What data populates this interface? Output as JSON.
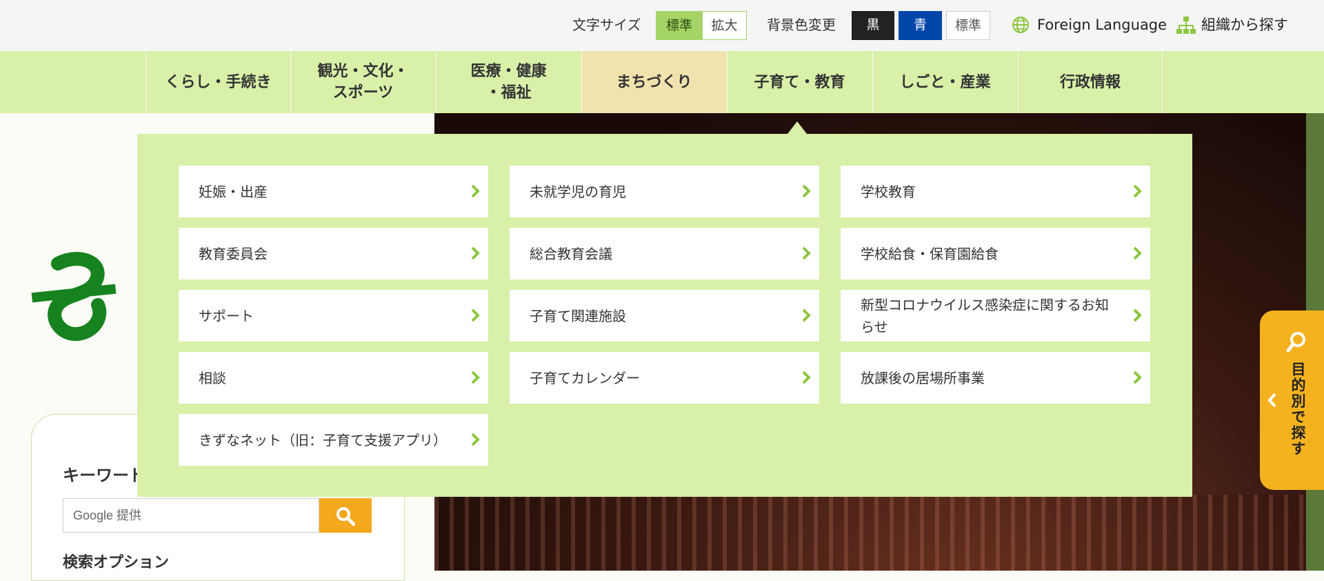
{
  "utility": {
    "font_size_label": "文字サイズ",
    "font_size_standard": "標準",
    "font_size_large": "拡大",
    "bg_color_label": "背景色変更",
    "bg_black": "黒",
    "bg_blue": "青",
    "bg_standard": "標準",
    "foreign_language": "Foreign Language",
    "org_search": "組織から探す"
  },
  "nav": {
    "items": [
      {
        "label": "くらし・手続き"
      },
      {
        "label": "観光・文化・\nスポーツ"
      },
      {
        "label": "医療・健康\n・福祉"
      },
      {
        "label": "まちづくり"
      },
      {
        "label": "子育て・教育"
      },
      {
        "label": "しごと・産業"
      },
      {
        "label": "行政情報"
      }
    ]
  },
  "dropdown": {
    "items": [
      {
        "label": "妊娠・出産"
      },
      {
        "label": "未就学児の育児"
      },
      {
        "label": "学校教育"
      },
      {
        "label": "教育委員会"
      },
      {
        "label": "総合教育会議"
      },
      {
        "label": "学校給食・保育園給食"
      },
      {
        "label": "サポート"
      },
      {
        "label": "子育て関連施設"
      },
      {
        "label": "新型コロナウイルス感染症に関するお知らせ"
      },
      {
        "label": "相談"
      },
      {
        "label": "子育てカレンダー"
      },
      {
        "label": "放課後の居場所事業"
      },
      {
        "label": "きずなネット（旧：子育て支援アプリ）"
      }
    ]
  },
  "search": {
    "title": "キーワード",
    "placeholder": "Google 提供",
    "options_label": "検索オプション"
  },
  "side_tab": {
    "label": "目的別で探す"
  },
  "colors": {
    "nav_bg": "#d8f0a8",
    "nav_active": "#f2e3ae",
    "accent_green": "#a3d465",
    "side_tab": "#f4b21e",
    "logo_green": "#16831f"
  }
}
